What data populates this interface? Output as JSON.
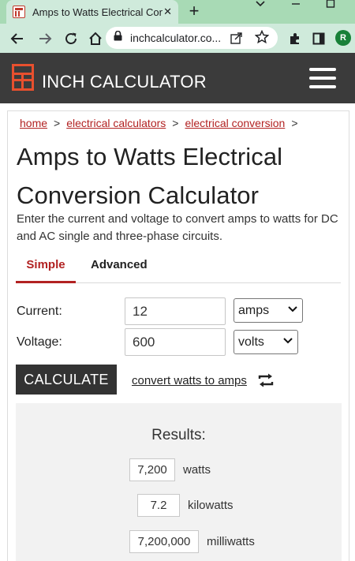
{
  "browser": {
    "tab_title": "Amps to Watts Electrical Conv",
    "tab_close": "✕",
    "new_tab": "+",
    "url": "inchcalculator.co...",
    "profile_initial": "R"
  },
  "site": {
    "logo_text": "INCH CALCULATOR"
  },
  "breadcrumb": {
    "items": [
      "home",
      "electrical calculators",
      "electrical conversion"
    ],
    "separator": ">"
  },
  "page": {
    "title": "Amps to Watts Electrical Conversion Calculator",
    "intro": "Enter the current and voltage to convert amps to watts for DC and AC single and three-phase circuits."
  },
  "tabs": {
    "simple": "Simple",
    "advanced": "Advanced",
    "active": "Simple"
  },
  "form": {
    "current_label": "Current:",
    "current_value": "12",
    "current_unit": "amps",
    "voltage_label": "Voltage:",
    "voltage_value": "600",
    "voltage_unit": "volts",
    "calculate_label": "CALCULATE",
    "convert_link": "convert watts to amps"
  },
  "results": {
    "title": "Results:",
    "rows": [
      {
        "value": "7,200",
        "unit": "watts"
      },
      {
        "value": "7.2",
        "unit": "kilowatts"
      },
      {
        "value": "7,200,000",
        "unit": "milliwatts"
      }
    ]
  },
  "colors": {
    "brand_orange": "#e8502e",
    "accent_red": "#b22222",
    "header_bg": "#3b3b3b",
    "browser_tab_green": "#a8dab5"
  },
  "icons": {
    "back": "back-arrow-icon",
    "forward": "forward-arrow-icon",
    "reload": "reload-icon",
    "home": "home-icon",
    "lock": "lock-icon",
    "share": "share-icon",
    "star": "star-icon",
    "extensions": "puzzle-icon",
    "sidebar": "side-panel-icon",
    "menu": "hamburger-menu-icon",
    "swap": "swap-icon"
  }
}
